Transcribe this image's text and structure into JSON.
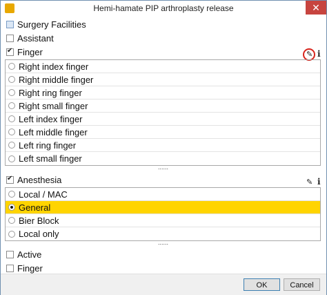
{
  "window": {
    "title": "Hemi-hamate PIP arthroplasty release",
    "close_glyph": "✕"
  },
  "sections": {
    "surgery_facilities": "Surgery Facilities",
    "assistant": "Assistant",
    "finger": "Finger",
    "anesthesia": "Anesthesia",
    "active": "Active",
    "finger2": "Finger"
  },
  "finger_options": [
    "Right index finger",
    "Right middle finger",
    "Right ring finger",
    "Right small finger",
    "Left index finger",
    "Left middle finger",
    "Left ring finger",
    "Left small finger"
  ],
  "anesthesia_options": [
    "Local / MAC",
    "General",
    "Bier Block",
    "Local only"
  ],
  "anesthesia_selected": "General",
  "grip": "......",
  "icons": {
    "edit": "pencil-icon",
    "info": "info-icon",
    "edit_glyph": "✎",
    "info_glyph": "i"
  },
  "footer": {
    "ok": "OK",
    "cancel": "Cancel"
  },
  "colors": {
    "selection": "#ffd400",
    "highlight_ring": "#d8241c",
    "close": "#c7443f"
  }
}
